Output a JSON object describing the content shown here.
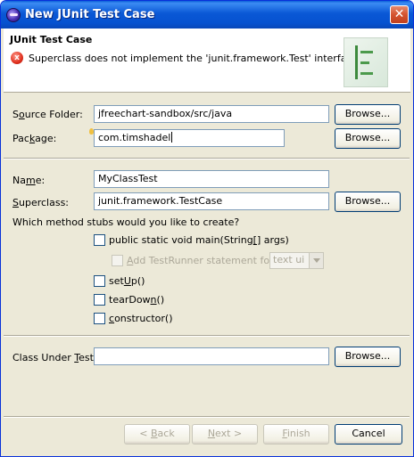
{
  "window": {
    "title": "New JUnit Test Case",
    "close_glyph": "✕"
  },
  "banner": {
    "title": "JUnit Test Case",
    "error_message": "Superclass does not implement the 'junit.framework.Test' interface.",
    "error_icon_glyph": "x"
  },
  "form": {
    "source_folder": {
      "label_pre": "S",
      "label_u": "o",
      "label_post": "urce Folder:",
      "value": "jfreechart-sandbox/src/java",
      "browse": "Browse..."
    },
    "package": {
      "label_pre": "Pac",
      "label_u": "k",
      "label_post": "age:",
      "value": "com.timshadel",
      "browse": "Browse..."
    },
    "name": {
      "label_pre": "Na",
      "label_u": "m",
      "label_post": "e:",
      "value": "MyClassTest"
    },
    "superclass": {
      "label_pre": "",
      "label_u": "S",
      "label_post": "uperclass:",
      "value": "junit.framework.TestCase",
      "browse": "Browse..."
    },
    "stubs_question": "Which method stubs would you like to create?",
    "stubs": {
      "main": {
        "label_pre": "public static void main(String",
        "label_u": "[",
        "label_post": "] args)",
        "checked": false
      },
      "testrunner": {
        "label_pre": "",
        "label_u": "A",
        "label_post": "dd TestRunner statement for:",
        "checked": false,
        "enabled": false,
        "combo_value": "text ui"
      },
      "setup": {
        "label_pre": "set",
        "label_u": "U",
        "label_post": "p()",
        "checked": false
      },
      "teardown": {
        "label_pre": "tearDow",
        "label_u": "n",
        "label_post": "()",
        "checked": false
      },
      "constructor": {
        "label_pre": "",
        "label_u": "c",
        "label_post": "onstructor()",
        "checked": false
      }
    },
    "class_under_test": {
      "label_pre": "Class Under ",
      "label_u": "T",
      "label_post": "est:",
      "value": "",
      "browse": "Browse..."
    }
  },
  "footer": {
    "back": {
      "pre": "< ",
      "u": "B",
      "post": "ack"
    },
    "next": {
      "pre": "",
      "u": "N",
      "post": "ext >"
    },
    "finish": {
      "pre": "",
      "u": "F",
      "post": "inish"
    },
    "cancel": "Cancel"
  },
  "colors": {
    "title_bar": "#0a58d6",
    "dialog_bg": "#ece9d8",
    "error_red": "#e0301e",
    "field_border": "#7f9db9"
  },
  "icons": {
    "app": "eclipse-icon",
    "error": "error-icon",
    "banner": "junit-wizard-graphic-icon"
  }
}
